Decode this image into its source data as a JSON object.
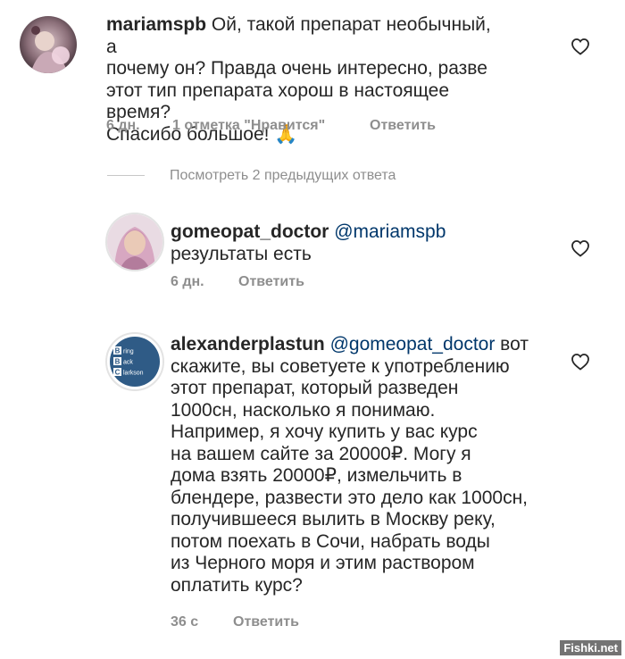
{
  "comments": [
    {
      "username": "mariamspb",
      "text_parts": [
        " Ой, такой препарат необычный, а",
        "почему он? Правда очень интересно, разве",
        "этот тип препарата хорош в настоящее время?",
        "Спасибо большое! 🙏"
      ],
      "time": "6 дн.",
      "likes": "1 отметка \"Нравится\"",
      "reply_label": "Ответить"
    },
    {
      "username": "gomeopat_doctor",
      "mention": "@mariamspb",
      "text_parts": [
        "результаты  есть"
      ],
      "time": "6 дн.",
      "reply_label": "Ответить"
    },
    {
      "username": "alexanderplastun",
      "mention": "@gomeopat_doctor",
      "first_line_tail": " вот",
      "text_parts": [
        "скажите, вы советуете к употреблению",
        "этот препарат, который разведен",
        "1000сн, насколько я понимаю.",
        "Например, я хочу купить у вас курс",
        "на вашем сайте за 20000₽. Могу я",
        "дома взять 20000₽, измельчить в",
        "блендере, развести это дело как 1000сн,",
        "получившееся вылить в Москву реку,",
        "потом поехать в Сочи, набрать воды",
        "из Черного моря и этим раствором",
        "оплатить курс?"
      ],
      "time": "36 с",
      "reply_label": "Ответить",
      "avatar_letters": [
        "B",
        "ring",
        "B",
        "ack",
        "C",
        "larkson"
      ]
    }
  ],
  "view_previous": "Посмотреть 2 предыдущих ответа",
  "watermark": "Fishki.net",
  "colors": {
    "text": "#262626",
    "meta": "#8e8e8e",
    "mention": "#00376b",
    "bbc_bg": "#3a5f8a"
  },
  "icons": {
    "like": "heart-outline-icon"
  }
}
